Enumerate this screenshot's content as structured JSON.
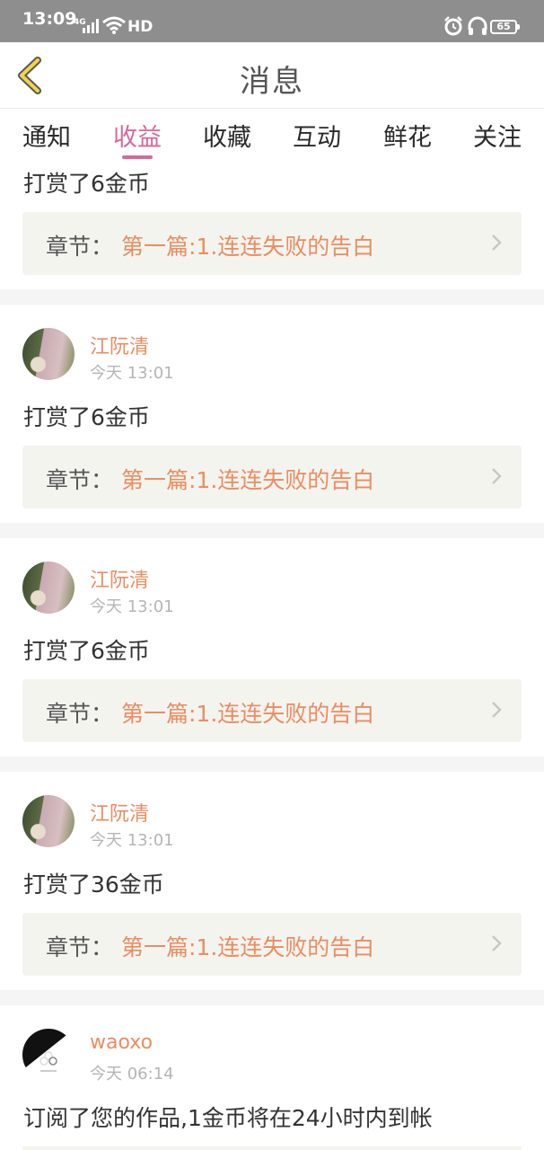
{
  "status": {
    "time": "13:09",
    "signal": "4G",
    "hd": "HD",
    "battery": "65"
  },
  "header": {
    "title": "消息"
  },
  "tabs": [
    {
      "label": "通知"
    },
    {
      "label": "收益"
    },
    {
      "label": "收藏"
    },
    {
      "label": "互动"
    },
    {
      "label": "鲜花"
    },
    {
      "label": "关注"
    }
  ],
  "active_tab": "收益",
  "colors": {
    "accent": "#d9679b",
    "highlight": "#e98d62",
    "status_bar": "#8e8e8e"
  },
  "messages": [
    {
      "text": "打赏了6金币",
      "chapter_label": "章节：",
      "chapter_name": "第一篇:1.连连失败的告白"
    },
    {
      "user": "江阮清",
      "time": "今天 13:01",
      "text": "打赏了6金币",
      "chapter_label": "章节：",
      "chapter_name": "第一篇:1.连连失败的告白"
    },
    {
      "user": "江阮清",
      "time": "今天 13:01",
      "text": "打赏了6金币",
      "chapter_label": "章节：",
      "chapter_name": "第一篇:1.连连失败的告白"
    },
    {
      "user": "江阮清",
      "time": "今天 13:01",
      "text": "打赏了36金币",
      "chapter_label": "章节：",
      "chapter_name": "第一篇:1.连连失败的告白"
    },
    {
      "user": "waoxo",
      "time": "今天 06:14",
      "text": "订阅了您的作品,1金币将在24小时内到帐"
    }
  ]
}
